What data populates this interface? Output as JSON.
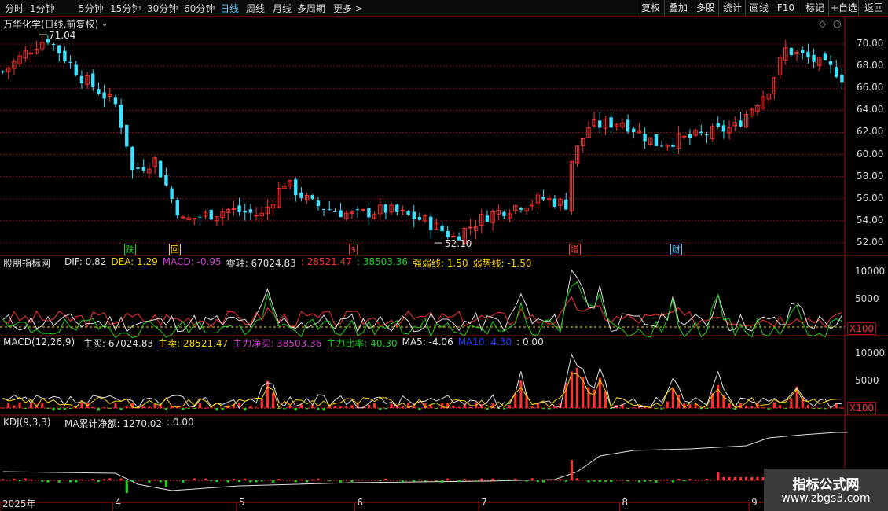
{
  "toolbar": {
    "periods": [
      "分时",
      "1分钟",
      "5分钟",
      "15分钟",
      "30分钟",
      "60分钟",
      "日线",
      "周线",
      "月线",
      "多周期",
      "更多 >"
    ],
    "active_period": "日线",
    "right_buttons": [
      "复权",
      "叠加",
      "多股",
      "统计",
      "画线",
      "F10",
      "+自选",
      "返回"
    ],
    "mark_label": "标记"
  },
  "main_panel": {
    "title": "万华化学(日线,前复权)",
    "high_marker": "71.04",
    "low_marker": "52.10",
    "price_axis": [
      "70.00",
      "68.00",
      "66.00",
      "64.00",
      "62.00",
      "60.00",
      "58.00",
      "56.00",
      "54.00",
      "52.00"
    ],
    "signals": [
      {
        "text": "跌",
        "color": "#1fd01f",
        "index": 22
      },
      {
        "text": "回",
        "color": "#ffd700",
        "index": 30
      },
      {
        "text": "$",
        "color": "#ff3030",
        "index": 62
      },
      {
        "text": "增",
        "color": "#ff4040",
        "index": 101
      },
      {
        "text": "财",
        "color": "#55c8ff",
        "index": 119
      }
    ]
  },
  "panel1": {
    "name": "股朋指标网",
    "items": [
      {
        "text": "DIF: 0.82",
        "color": "#e0e0e0"
      },
      {
        "text": "DEA: 1.29",
        "color": "#ffd700"
      },
      {
        "text": "MACD: -0.95",
        "color": "#d040d0"
      },
      {
        "text": "零轴: 67024.83",
        "color": "#e0e0e0"
      },
      {
        "text": ": 28521.47",
        "color": "#ff3030"
      },
      {
        "text": ": 38503.36",
        "color": "#1fd01f"
      },
      {
        "text": "强弱线: 1.50",
        "color": "#ffd700"
      },
      {
        "text": "弱势线: -1.50",
        "color": "#ffd700"
      }
    ],
    "axis": [
      "10000",
      "5000"
    ],
    "multiplier": "X100"
  },
  "panel2": {
    "name": "MACD(12,26,9)",
    "items": [
      {
        "text": "主买: 67024.83",
        "color": "#e0e0e0"
      },
      {
        "text": "主卖: 28521.47",
        "color": "#ffd700"
      },
      {
        "text": "主力净买: 38503.36",
        "color": "#d040d0"
      },
      {
        "text": "主力比率: 40.30",
        "color": "#1fd01f"
      },
      {
        "text": "MA5: -4.06",
        "color": "#e0e0e0"
      },
      {
        "text": "MA10: 4.30",
        "color": "#2040ff"
      },
      {
        "text": ": 0.00",
        "color": "#e0e0e0"
      }
    ],
    "axis": [
      "10000",
      "5000"
    ],
    "multiplier": "X100"
  },
  "panel3": {
    "name": "KDJ(9,3,3)",
    "items": [
      {
        "text": "MA累计净额: 1270.02",
        "color": "#e0e0e0"
      },
      {
        "text": ": 0.00",
        "color": "#e0e0e0"
      }
    ]
  },
  "date_axis": [
    {
      "text": "2025年",
      "index": 0
    },
    {
      "text": "4",
      "index": 20
    },
    {
      "text": "5",
      "index": 42
    },
    {
      "text": "6",
      "index": 63
    },
    {
      "text": "7",
      "index": 85
    },
    {
      "text": "8",
      "index": 110
    },
    {
      "text": "9",
      "index": 133
    }
  ],
  "watermark": {
    "title": "指标公式网",
    "url": "www.zbgs3.com"
  },
  "colors": {
    "up": "#ff3030",
    "down": "#40e0ff",
    "grid": "#7a1010",
    "bg": "#000000"
  }
}
